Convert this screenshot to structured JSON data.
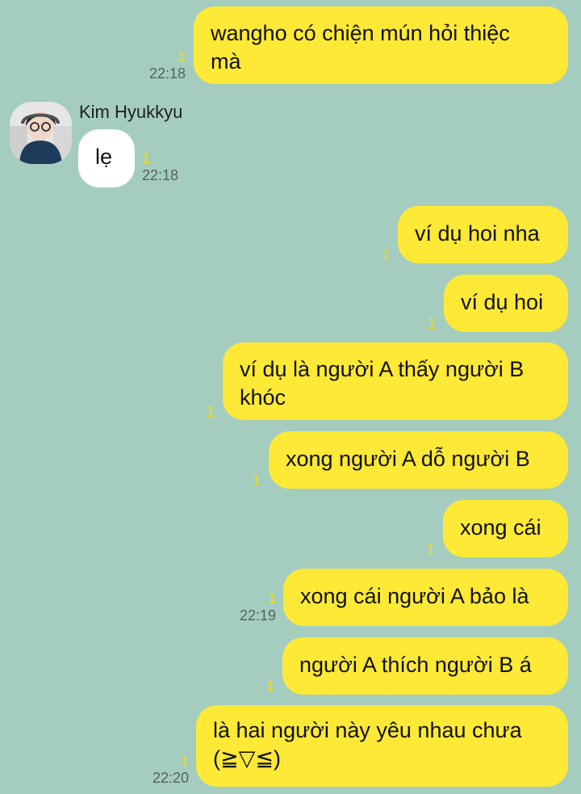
{
  "contact": {
    "name": "Kim Hyukkyu",
    "colors": {
      "background": "#a4cdbf",
      "outgoing_bubble": "#fde936",
      "incoming_bubble": "#ffffff",
      "unread": "#f4da1e"
    }
  },
  "messages": [
    {
      "lines": [
        "wangho có chiện mún hỏi thiệc",
        "mà"
      ],
      "unread": "1",
      "time": "22:18"
    },
    {
      "lines": [
        "lẹ"
      ],
      "unread": "1",
      "time": "22:18"
    },
    {
      "lines": [
        "ví dụ hoi nha"
      ],
      "unread": "1",
      "time": ""
    },
    {
      "lines": [
        "ví dụ hoi"
      ],
      "unread": "1",
      "time": ""
    },
    {
      "lines": [
        "ví dụ là người A thấy người B",
        "khóc"
      ],
      "unread": "1",
      "time": ""
    },
    {
      "lines": [
        "xong người A dỗ người B"
      ],
      "unread": "1",
      "time": ""
    },
    {
      "lines": [
        "xong cái"
      ],
      "unread": "1",
      "time": ""
    },
    {
      "lines": [
        "xong cái người A bảo là"
      ],
      "unread": "1",
      "time": "22:19"
    },
    {
      "lines": [
        "người A thích người B á"
      ],
      "unread": "1",
      "time": ""
    },
    {
      "lines": [
        "là hai người này yêu nhau chưa",
        "(≧▽≦)"
      ],
      "unread": "1",
      "time": "22:20"
    }
  ]
}
